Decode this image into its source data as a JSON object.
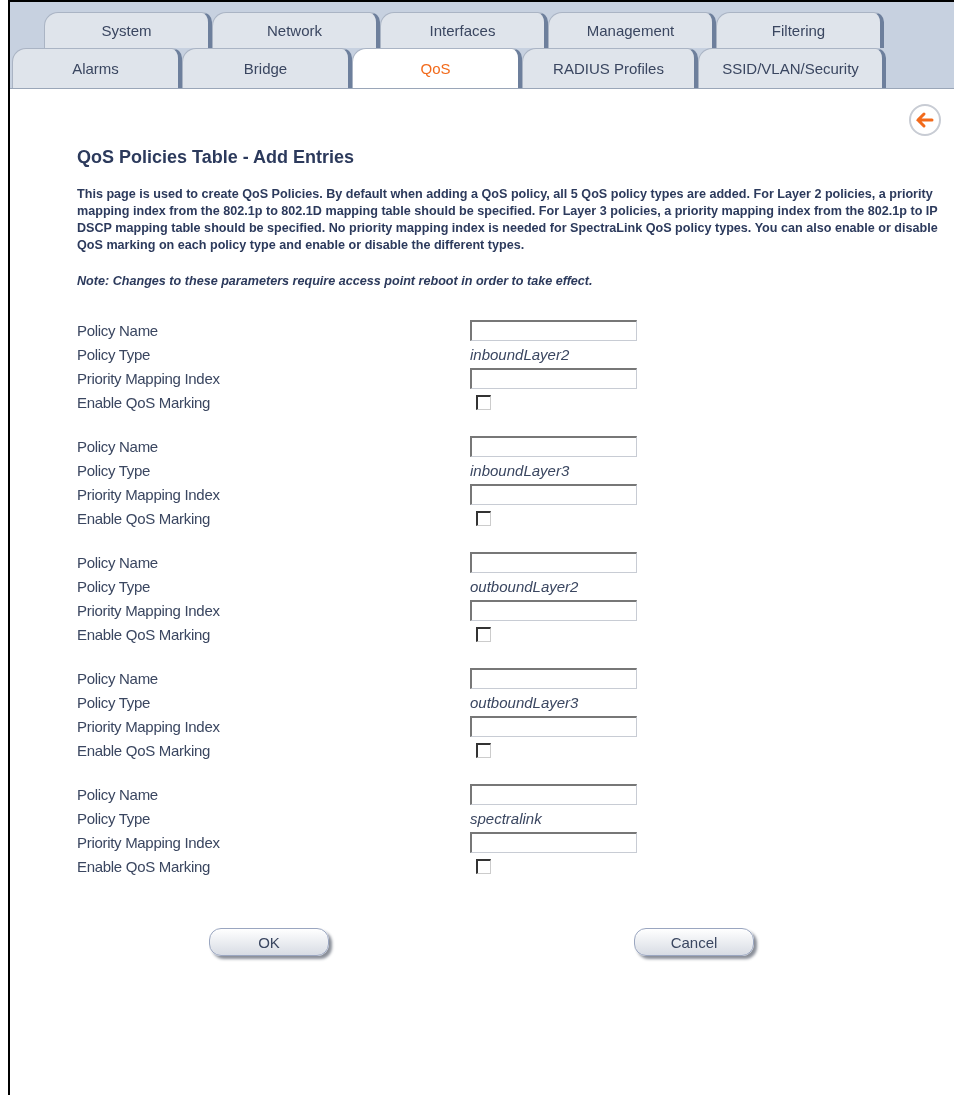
{
  "tabs_top": [
    {
      "label": "System",
      "selected": false
    },
    {
      "label": "Network",
      "selected": false
    },
    {
      "label": "Interfaces",
      "selected": false
    },
    {
      "label": "Management",
      "selected": false
    },
    {
      "label": "Filtering",
      "selected": false
    }
  ],
  "tabs_sub": [
    {
      "label": "Alarms",
      "selected": false
    },
    {
      "label": "Bridge",
      "selected": false
    },
    {
      "label": "QoS",
      "selected": true
    },
    {
      "label": "RADIUS Profiles",
      "selected": false
    },
    {
      "label": "SSID/VLAN/Security",
      "selected": false
    }
  ],
  "title": "QoS Policies Table - Add Entries",
  "description": "This page is used to create QoS Policies. By default when adding a QoS policy, all 5 QoS policy types are added. For Layer 2 policies, a priority mapping index from the 802.1p to 802.1D mapping table should be specified. For Layer 3 policies, a priority mapping index from the 802.1p to IP DSCP mapping table should be specified. No priority mapping index is needed for SpectraLink QoS policy types. You can also enable or disable QoS marking on each policy type and enable or disable the different types.",
  "note": "Note: Changes to these parameters require access point reboot in order to take effect.",
  "policies": [
    {
      "labels": [
        "Policy Name",
        "Policy Type",
        "Priority Mapping Index",
        "Enable QoS Marking"
      ],
      "policy_type": "inboundLayer2",
      "marking": false
    },
    {
      "labels": [
        "Policy Name",
        "Policy Type",
        "Priority Mapping Index",
        "Enable QoS Marking"
      ],
      "policy_type": "inboundLayer3",
      "marking": false
    },
    {
      "labels": [
        "Policy Name",
        "Policy Type",
        "Priority Mapping Index",
        "Enable QoS Marking"
      ],
      "policy_type": "outboundLayer2",
      "marking": false
    },
    {
      "labels": [
        "Policy Name",
        "Policy Type",
        "Priority Mapping Index",
        "Enable QoS Marking"
      ],
      "policy_type": "outboundLayer3",
      "marking": false
    },
    {
      "labels": [
        "Policy Name",
        "Policy Type",
        "Priority Mapping Index",
        "Enable QoS Marking"
      ],
      "policy_type": "spectralink",
      "marking": false
    }
  ],
  "buttons": [
    "OK",
    "Cancel"
  ]
}
